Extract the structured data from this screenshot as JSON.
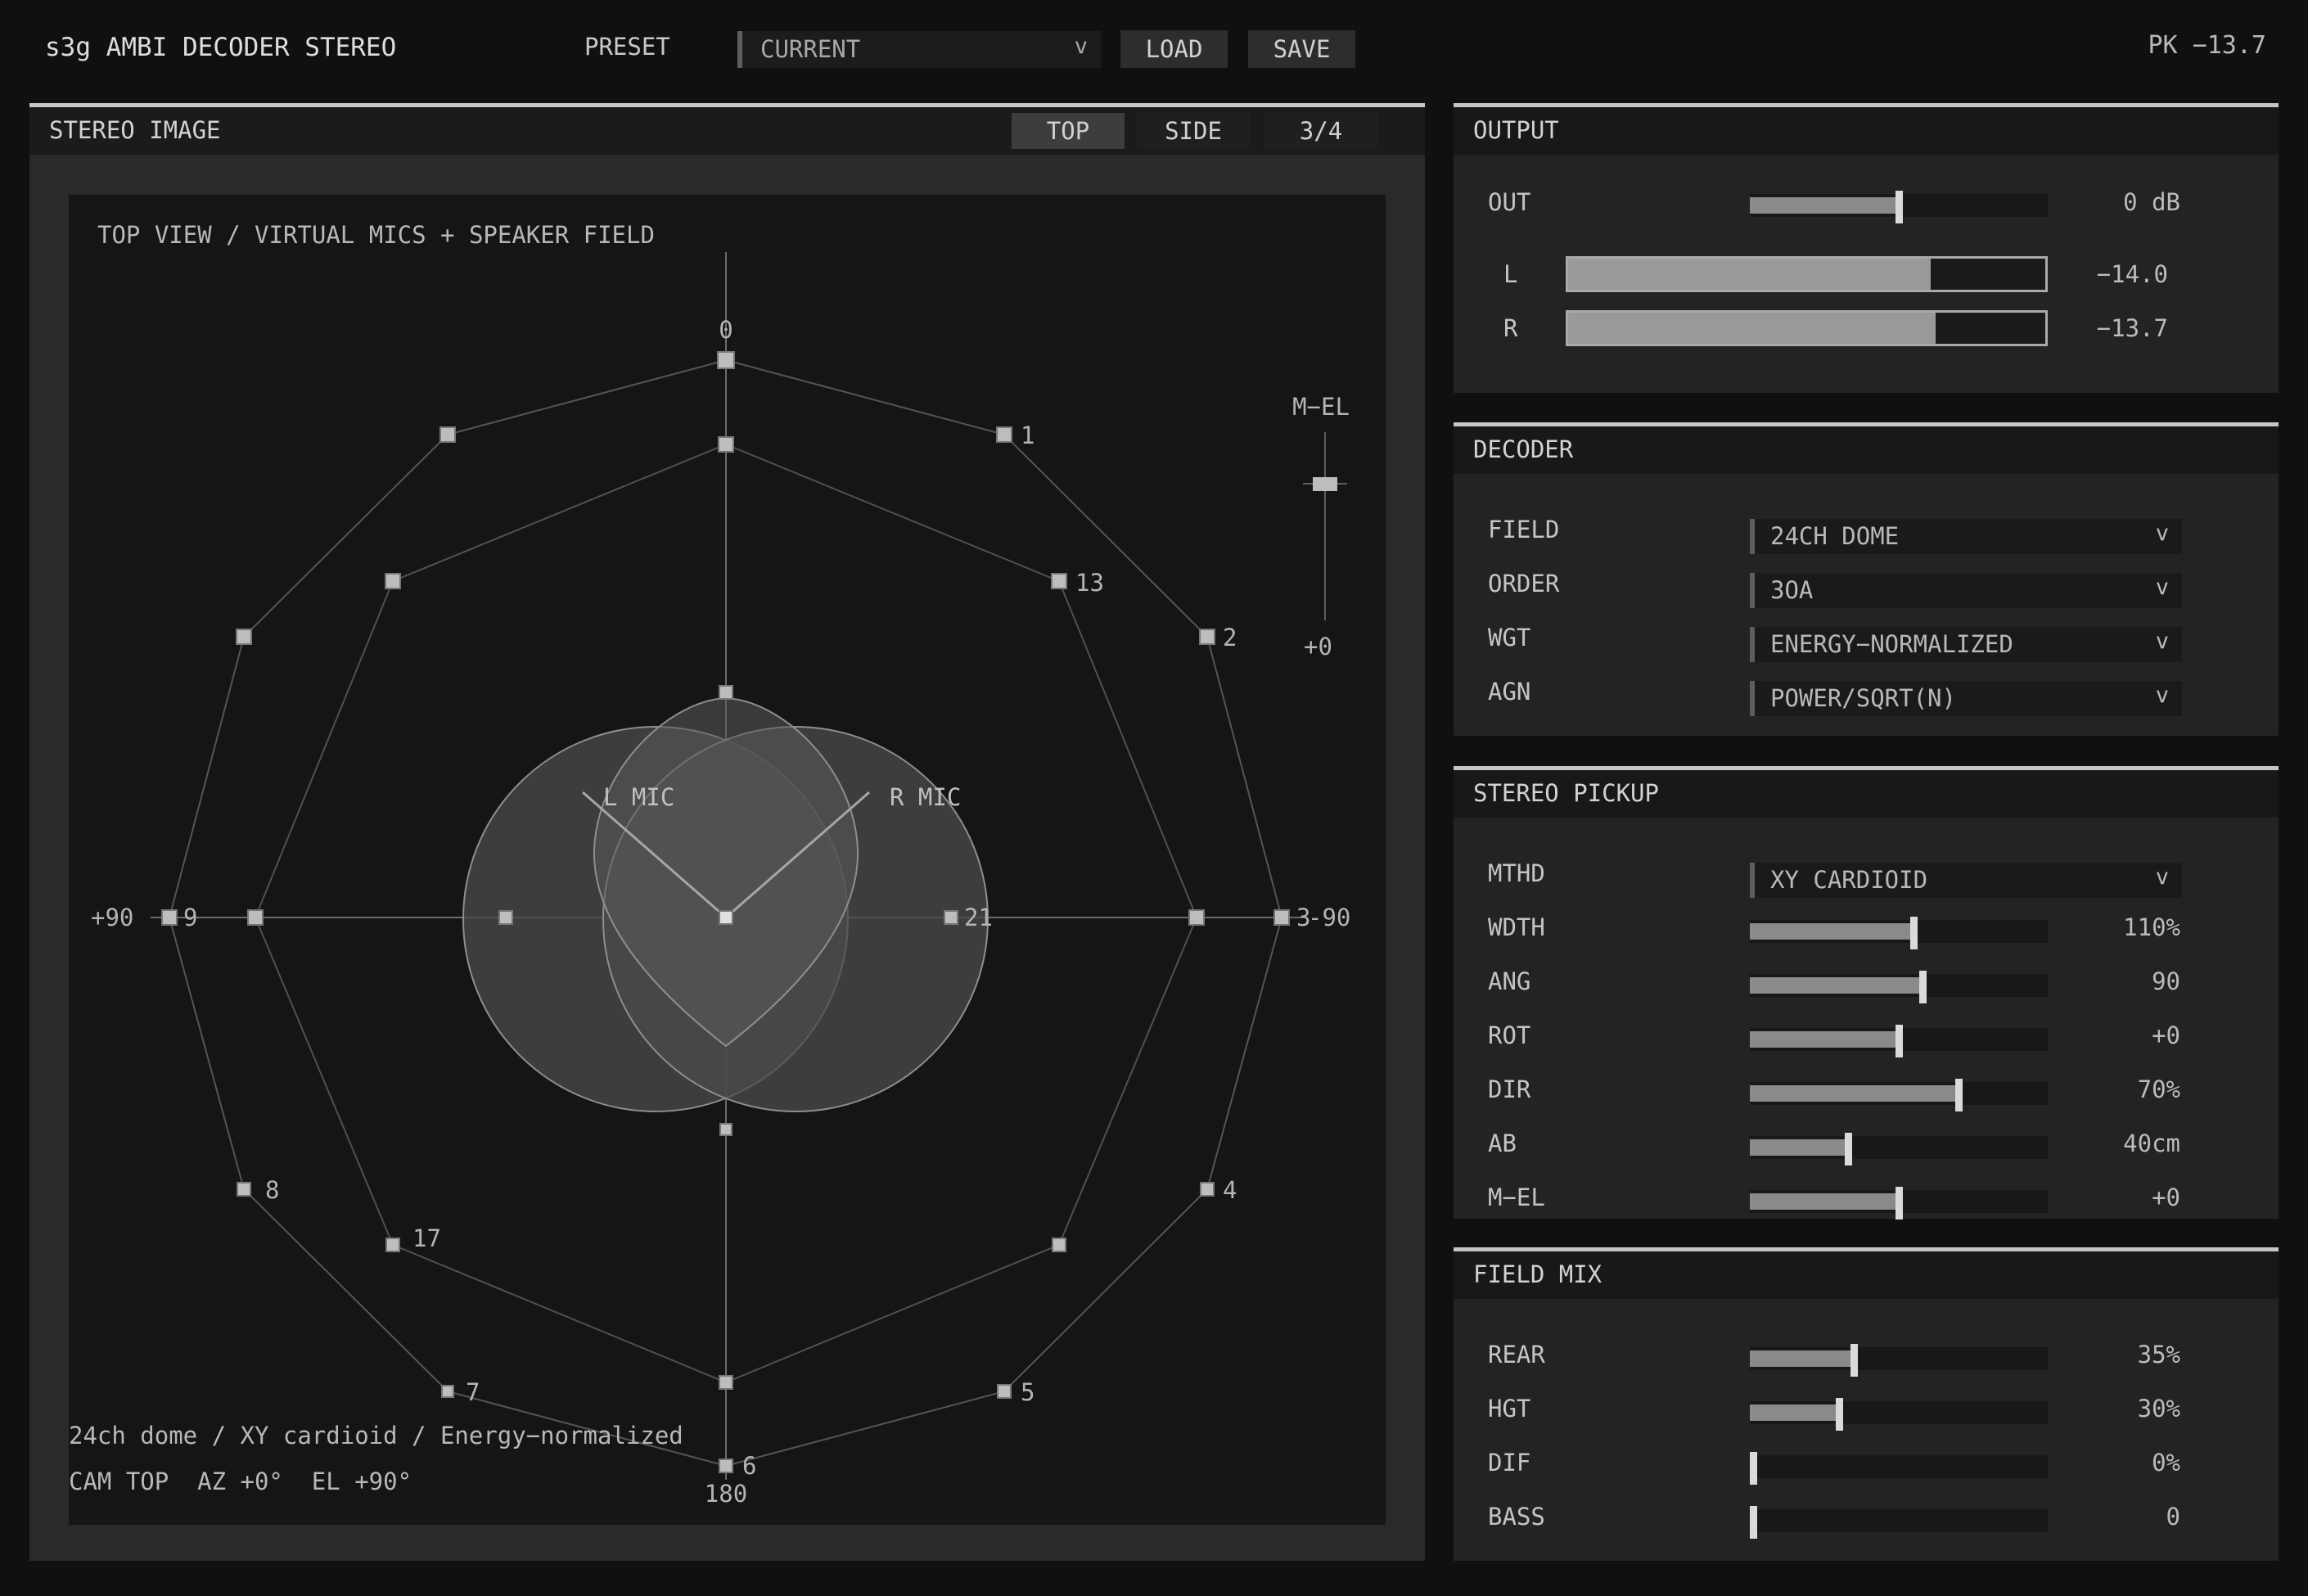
{
  "header": {
    "app_title": "s3g AMBI DECODER STEREO",
    "preset_label": "PRESET",
    "preset_value": "CURRENT",
    "load_label": "LOAD",
    "save_label": "SAVE",
    "peak": "PK −13.7"
  },
  "stereo_image": {
    "title": "STEREO IMAGE",
    "views": [
      "TOP",
      "SIDE",
      "3/4"
    ],
    "active_view": "TOP",
    "plot_title": "TOP VIEW / VIRTUAL MICS + SPEAKER FIELD",
    "angle_front": "0",
    "angle_left": "+90",
    "angle_right": "-90",
    "angle_back": "180",
    "mel_label": "M−EL",
    "mel_value": "+0",
    "l_mic_label": "L MIC",
    "r_mic_label": "R MIC",
    "speaker_labels": [
      "1",
      "13",
      "2",
      "3",
      "21",
      "4",
      "5",
      "6",
      "7",
      "17",
      "8",
      "9"
    ],
    "info_line1": "24ch dome / XY cardioid / Energy−normalized",
    "info_line2": "CAM TOP  AZ +0°  EL +90°"
  },
  "output": {
    "title": "OUTPUT",
    "out_label": "OUT",
    "out_value": "0 dB",
    "out_level": 0.5,
    "l_label": "L",
    "l_value": "−14.0",
    "l_level": 0.76,
    "r_label": "R",
    "r_value": "−13.7",
    "r_level": 0.77
  },
  "decoder": {
    "title": "DECODER",
    "rows": [
      {
        "label": "FIELD",
        "value": "24CH DOME"
      },
      {
        "label": "ORDER",
        "value": "3OA"
      },
      {
        "label": "WGT",
        "value": "ENERGY−NORMALIZED"
      },
      {
        "label": "AGN",
        "value": "POWER/SQRT(N)"
      }
    ],
    "chevron": "v"
  },
  "pickup": {
    "title": "STEREO PICKUP",
    "method_label": "MTHD",
    "method_value": "XY CARDIOID",
    "sliders": [
      {
        "label": "WDTH",
        "value": "110%",
        "level": 0.55
      },
      {
        "label": "ANG",
        "value": "90",
        "level": 0.58
      },
      {
        "label": "ROT",
        "value": "+0",
        "level": 0.5
      },
      {
        "label": "DIR",
        "value": "70%",
        "level": 0.7
      },
      {
        "label": "AB",
        "value": "40cm",
        "level": 0.33
      },
      {
        "label": "M−EL",
        "value": "+0",
        "level": 0.5
      }
    ]
  },
  "field_mix": {
    "title": "FIELD MIX",
    "sliders": [
      {
        "label": "REAR",
        "value": "35%",
        "level": 0.35
      },
      {
        "label": "HGT",
        "value": "30%",
        "level": 0.3
      },
      {
        "label": "DIF",
        "value": "0%",
        "level": 0.0
      },
      {
        "label": "BASS",
        "value": "0",
        "level": 0.0
      }
    ]
  }
}
